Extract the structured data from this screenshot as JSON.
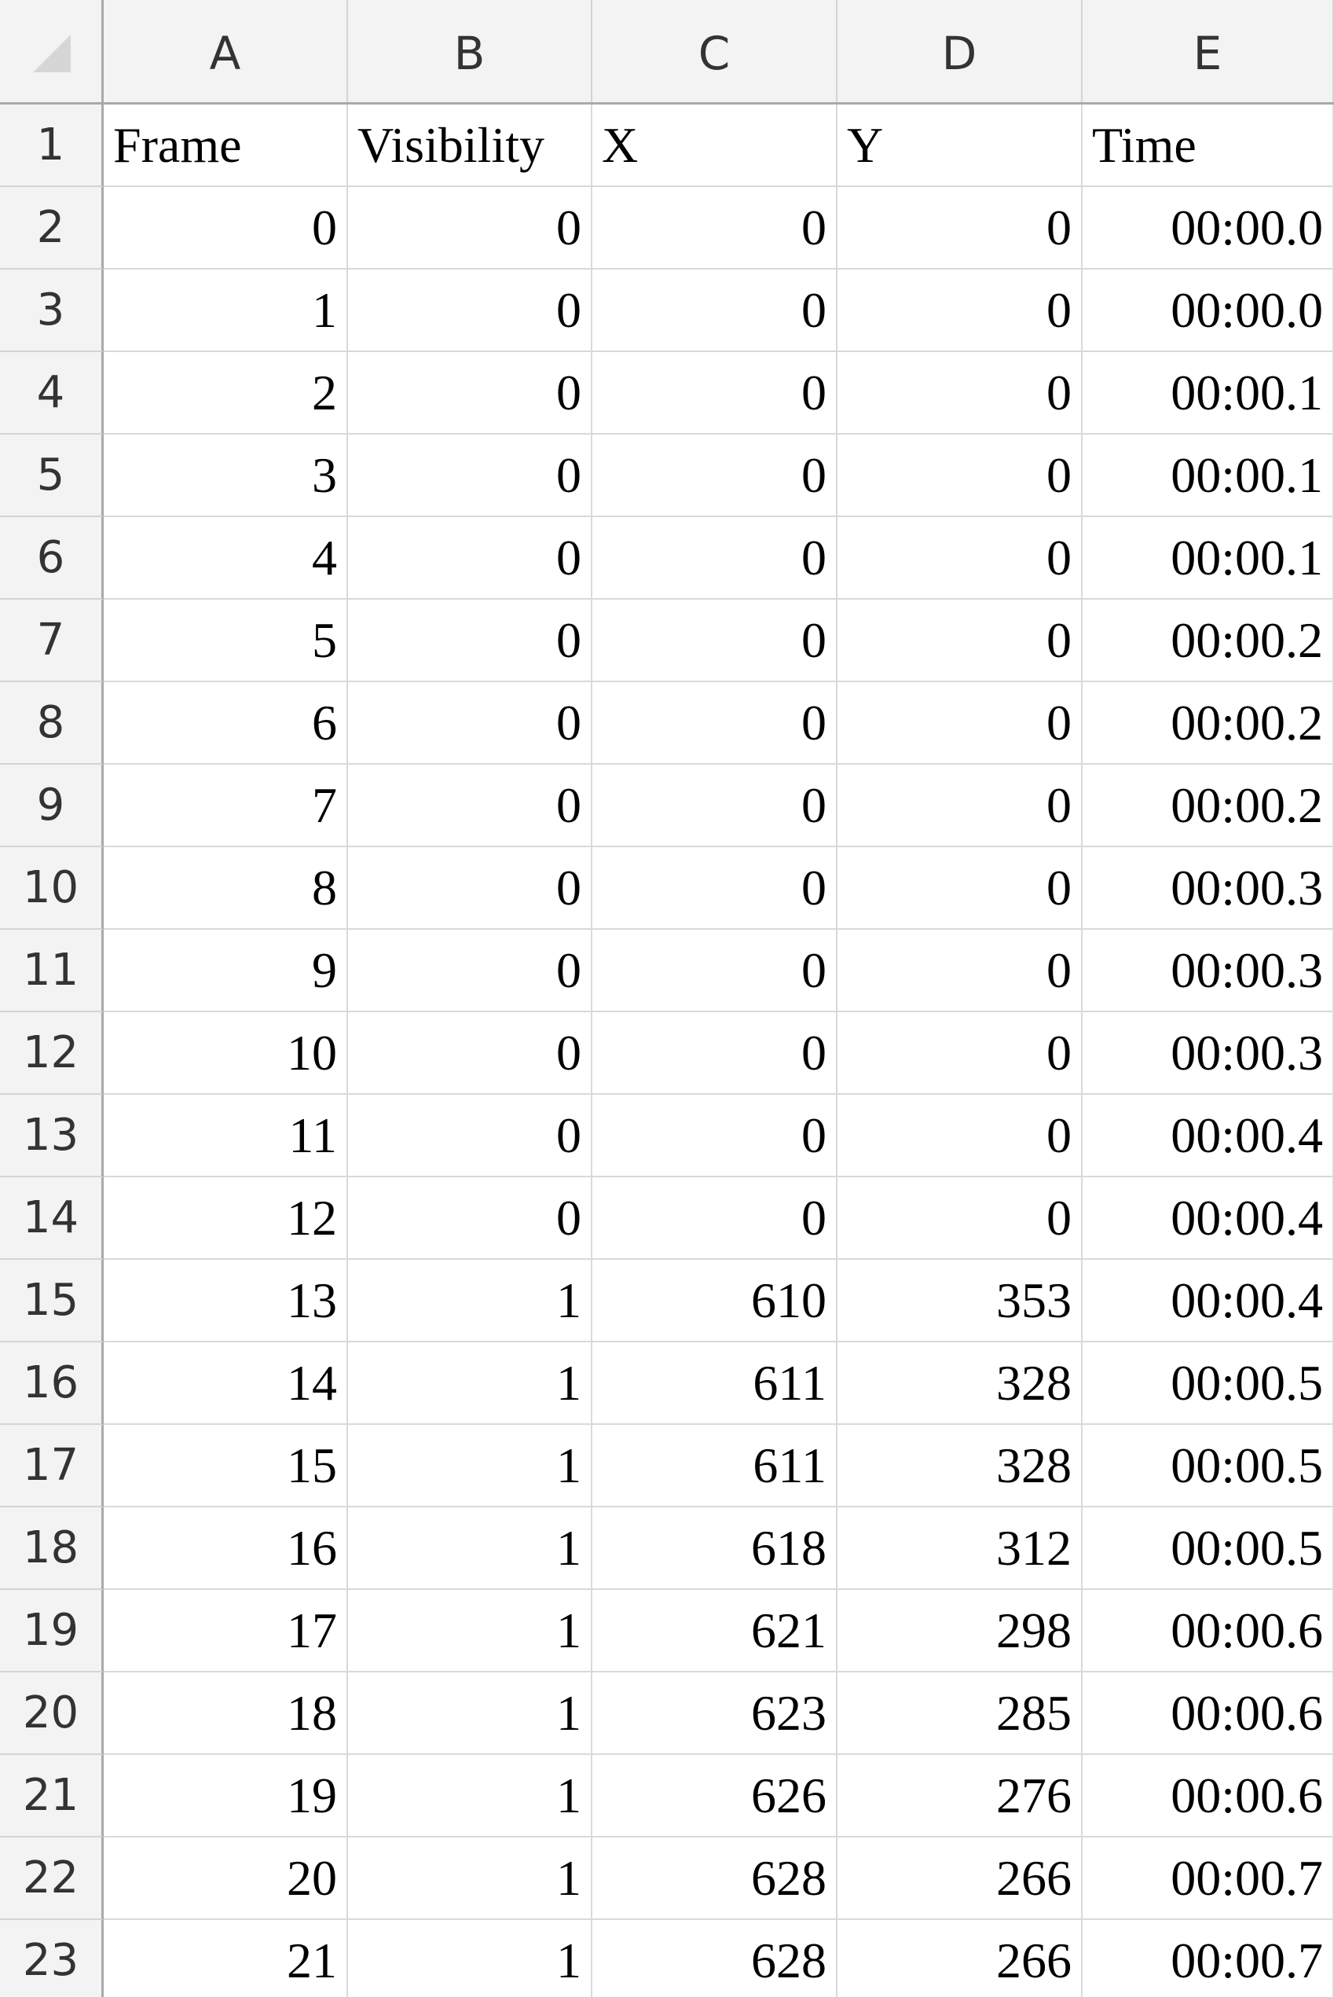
{
  "columns": [
    "A",
    "B",
    "C",
    "D",
    "E"
  ],
  "header_row": {
    "number": "1",
    "cells": [
      "Frame",
      "Visibility",
      "X",
      "Y",
      "Time"
    ]
  },
  "rows": [
    {
      "number": "2",
      "cells": [
        "0",
        "0",
        "0",
        "0",
        "00:00.0"
      ]
    },
    {
      "number": "3",
      "cells": [
        "1",
        "0",
        "0",
        "0",
        "00:00.0"
      ]
    },
    {
      "number": "4",
      "cells": [
        "2",
        "0",
        "0",
        "0",
        "00:00.1"
      ]
    },
    {
      "number": "5",
      "cells": [
        "3",
        "0",
        "0",
        "0",
        "00:00.1"
      ]
    },
    {
      "number": "6",
      "cells": [
        "4",
        "0",
        "0",
        "0",
        "00:00.1"
      ]
    },
    {
      "number": "7",
      "cells": [
        "5",
        "0",
        "0",
        "0",
        "00:00.2"
      ]
    },
    {
      "number": "8",
      "cells": [
        "6",
        "0",
        "0",
        "0",
        "00:00.2"
      ]
    },
    {
      "number": "9",
      "cells": [
        "7",
        "0",
        "0",
        "0",
        "00:00.2"
      ]
    },
    {
      "number": "10",
      "cells": [
        "8",
        "0",
        "0",
        "0",
        "00:00.3"
      ]
    },
    {
      "number": "11",
      "cells": [
        "9",
        "0",
        "0",
        "0",
        "00:00.3"
      ]
    },
    {
      "number": "12",
      "cells": [
        "10",
        "0",
        "0",
        "0",
        "00:00.3"
      ]
    },
    {
      "number": "13",
      "cells": [
        "11",
        "0",
        "0",
        "0",
        "00:00.4"
      ]
    },
    {
      "number": "14",
      "cells": [
        "12",
        "0",
        "0",
        "0",
        "00:00.4"
      ]
    },
    {
      "number": "15",
      "cells": [
        "13",
        "1",
        "610",
        "353",
        "00:00.4"
      ]
    },
    {
      "number": "16",
      "cells": [
        "14",
        "1",
        "611",
        "328",
        "00:00.5"
      ]
    },
    {
      "number": "17",
      "cells": [
        "15",
        "1",
        "611",
        "328",
        "00:00.5"
      ]
    },
    {
      "number": "18",
      "cells": [
        "16",
        "1",
        "618",
        "312",
        "00:00.5"
      ]
    },
    {
      "number": "19",
      "cells": [
        "17",
        "1",
        "621",
        "298",
        "00:00.6"
      ]
    },
    {
      "number": "20",
      "cells": [
        "18",
        "1",
        "623",
        "285",
        "00:00.6"
      ]
    },
    {
      "number": "21",
      "cells": [
        "19",
        "1",
        "626",
        "276",
        "00:00.6"
      ]
    },
    {
      "number": "22",
      "cells": [
        "20",
        "1",
        "628",
        "266",
        "00:00.7"
      ]
    },
    {
      "number": "23",
      "cells": [
        "21",
        "1",
        "628",
        "266",
        "00:00.7"
      ]
    }
  ]
}
